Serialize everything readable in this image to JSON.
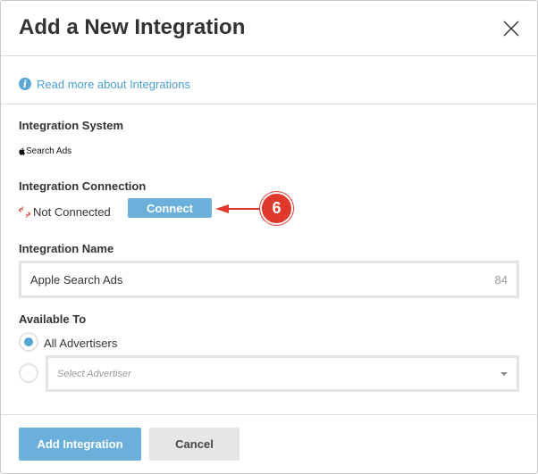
{
  "header": {
    "title": "Add a New Integration"
  },
  "info": {
    "link_text": "Read more about Integrations"
  },
  "system": {
    "label": "Integration System",
    "logo_text": "Search Ads"
  },
  "connection": {
    "label": "Integration Connection",
    "status": "Not Connected",
    "connect_label": "Connect",
    "annotation_number": "6",
    "annotation_color": "#e0392c"
  },
  "name": {
    "label": "Integration Name",
    "value": "Apple Search Ads",
    "char_count": "84"
  },
  "available": {
    "label": "Available To",
    "option_all": "All Advertisers",
    "option_all_selected": true,
    "select_placeholder": "Select Advertiser"
  },
  "footer": {
    "add_label": "Add Integration",
    "cancel_label": "Cancel"
  },
  "colors": {
    "accent": "#6ab0da",
    "link": "#4a9fd1"
  }
}
